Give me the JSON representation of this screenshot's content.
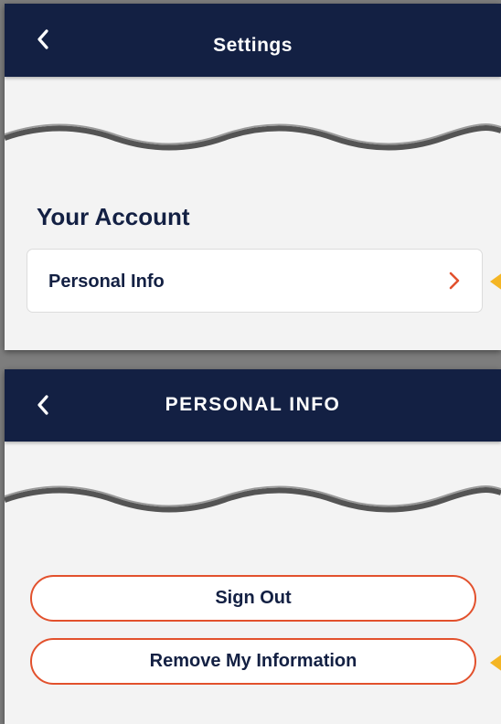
{
  "settings_screen": {
    "title": "Settings",
    "section_title": "Your Account",
    "personal_info_item": {
      "label": "Personal Info",
      "icon": "chevron-right-icon"
    },
    "back_icon": "chevron-left-icon"
  },
  "personal_info_screen": {
    "title": "PERSONAL INFO",
    "back_icon": "chevron-left-icon",
    "buttons": {
      "sign_out": "Sign Out",
      "remove_info": "Remove My Information"
    }
  },
  "colors": {
    "header_bg": "#132043",
    "accent": "#e2512d",
    "pointer": "#f4b524",
    "panel_bg": "#f3f3f3",
    "text_primary": "#132043"
  }
}
